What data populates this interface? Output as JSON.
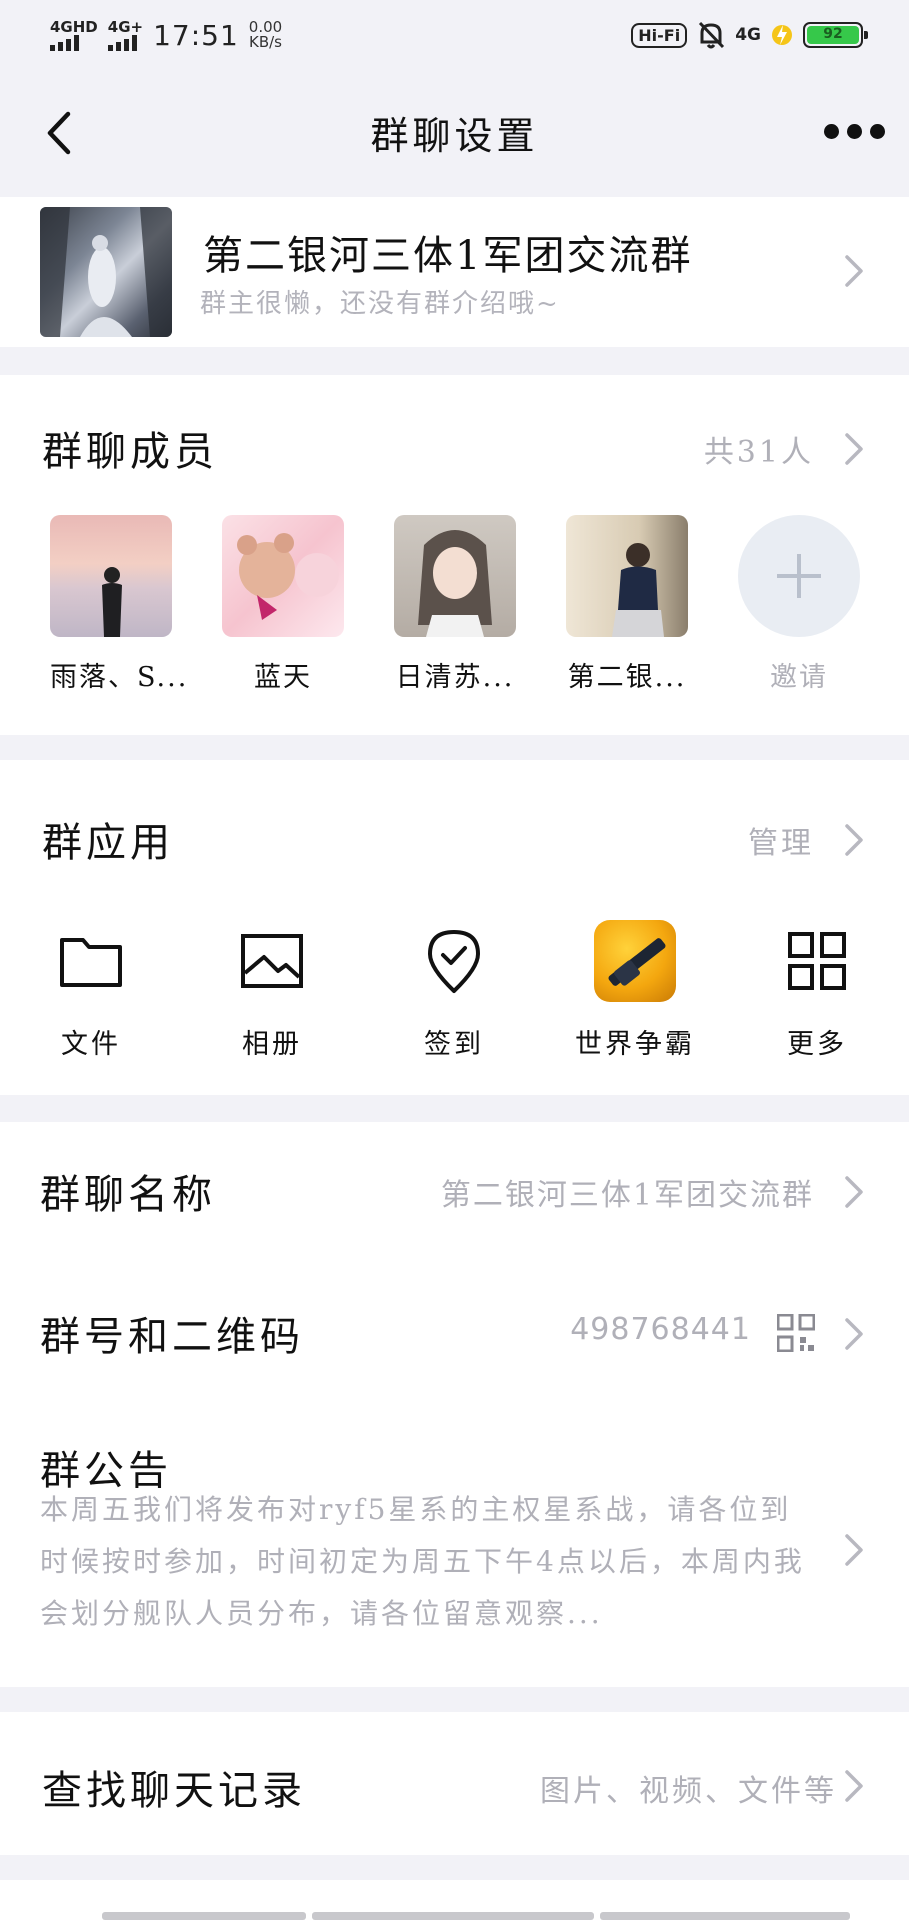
{
  "status_bar": {
    "signal1": "4GHD",
    "signal2": "4G+",
    "time": "17:51",
    "speed_value": "0.00",
    "speed_unit": "KB/s",
    "hifi": "Hi-Fi",
    "net": "4G",
    "battery": "92"
  },
  "nav": {
    "title": "群聊设置"
  },
  "group": {
    "name": "第二银河三体1军团交流群",
    "intro": "群主很懒，还没有群介绍哦~"
  },
  "members": {
    "title": "群聊成员",
    "count_label": "共31人",
    "items": [
      {
        "name": "雨落、S..."
      },
      {
        "name": "蓝天"
      },
      {
        "name": "日清苏..."
      },
      {
        "name": "第二银..."
      }
    ],
    "invite_label": "邀请"
  },
  "apps": {
    "title": "群应用",
    "manage_label": "管理",
    "items": [
      {
        "label": "文件",
        "icon": "folder-icon"
      },
      {
        "label": "相册",
        "icon": "image-icon"
      },
      {
        "label": "签到",
        "icon": "checkin-pin-icon"
      },
      {
        "label": "世界争霸",
        "icon": "game-app-icon"
      },
      {
        "label": "更多",
        "icon": "grid-icon"
      }
    ]
  },
  "info": {
    "name_label": "群聊名称",
    "name_value": "第二银河三体1军团交流群",
    "id_label": "群号和二维码",
    "id_value": "498768441",
    "notice_label": "群公告",
    "notice_text": "本周五我们将发布对ryf5星系的主权星系战，请各位到时候按时参加，时间初定为周五下午4点以后，本周内我会划分舰队人员分布，请各位留意观察..."
  },
  "search": {
    "label": "查找聊天记录",
    "hint": "图片、视频、文件等"
  },
  "colors": {
    "background": "#f2f2f7",
    "card": "#ffffff",
    "muted_text": "#b0b0b8",
    "battery_green": "#36c84a"
  }
}
